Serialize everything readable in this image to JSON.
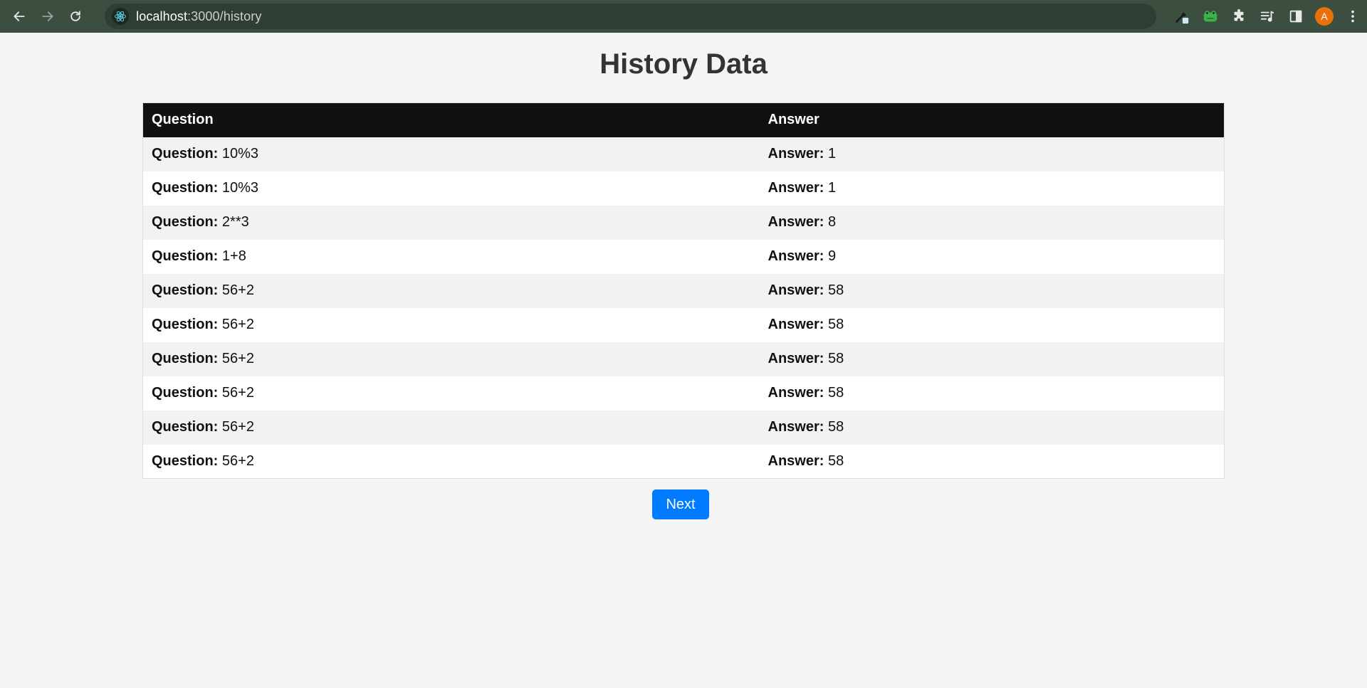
{
  "browser": {
    "url_host": "localhost",
    "url_path": ":3000/history",
    "avatar_letter": "A",
    "icons": [
      "back-arrow-icon",
      "forward-arrow-icon",
      "reload-icon",
      "react-site-icon",
      "eyedropper-icon",
      "frog-extension-icon",
      "puzzle-extensions-icon",
      "reading-list-icon",
      "side-panel-icon",
      "more-vert-icon"
    ]
  },
  "page": {
    "title": "History Data",
    "table": {
      "headers": {
        "question": "Question",
        "answer": "Answer"
      },
      "question_label": "Question:",
      "answer_label": "Answer:",
      "rows": [
        {
          "question": "10%3",
          "answer": "1"
        },
        {
          "question": "10%3",
          "answer": "1"
        },
        {
          "question": "2**3",
          "answer": "8"
        },
        {
          "question": "1+8",
          "answer": "9"
        },
        {
          "question": "56+2",
          "answer": "58"
        },
        {
          "question": "56+2",
          "answer": "58"
        },
        {
          "question": "56+2",
          "answer": "58"
        },
        {
          "question": "56+2",
          "answer": "58"
        },
        {
          "question": "56+2",
          "answer": "58"
        },
        {
          "question": "56+2",
          "answer": "58"
        }
      ]
    },
    "next_label": "Next"
  },
  "colors": {
    "chrome_bg": "#3c4e3f",
    "header_bg": "#111111",
    "button_bg": "#007bff",
    "page_bg": "#f4f4f4"
  }
}
